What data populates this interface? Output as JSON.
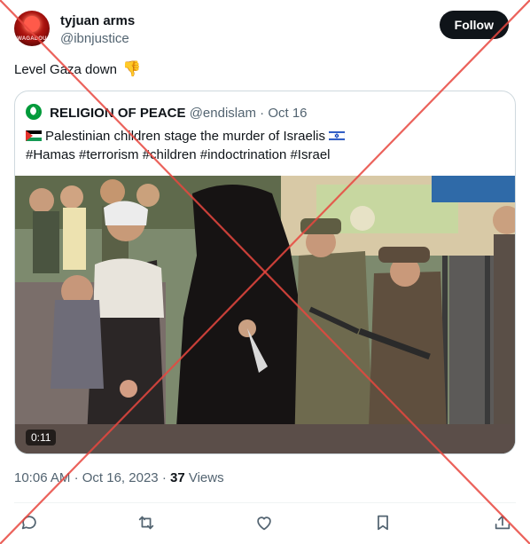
{
  "author": {
    "display_name": "tyjuan arms",
    "handle": "@ibnjustice",
    "avatar_icon": "red-avatar-icon"
  },
  "follow_label": "Follow",
  "tweet": {
    "text": "Level Gaza down",
    "emoji": "👎"
  },
  "quote": {
    "display_name": "RELIGION OF PEACE",
    "handle": "@endislam",
    "separator": "·",
    "date": "Oct 16",
    "text_line1": "Palestinian children stage the murder of Israelis",
    "hashtags": "#Hamas #terrorism #children #indoctrination #Israel",
    "video_duration": "0:11"
  },
  "meta": {
    "time": "10:06 AM",
    "separator1": "·",
    "date": "Oct 16, 2023",
    "separator2": "·",
    "views_count": "37",
    "views_label": "Views"
  },
  "actions": [
    "reply-icon",
    "retweet-icon",
    "like-icon",
    "bookmark-icon",
    "share-icon"
  ],
  "colors": {
    "follow_bg": "#0f1419",
    "secondary_text": "#536471",
    "overlay_cross": "#e8473f"
  }
}
